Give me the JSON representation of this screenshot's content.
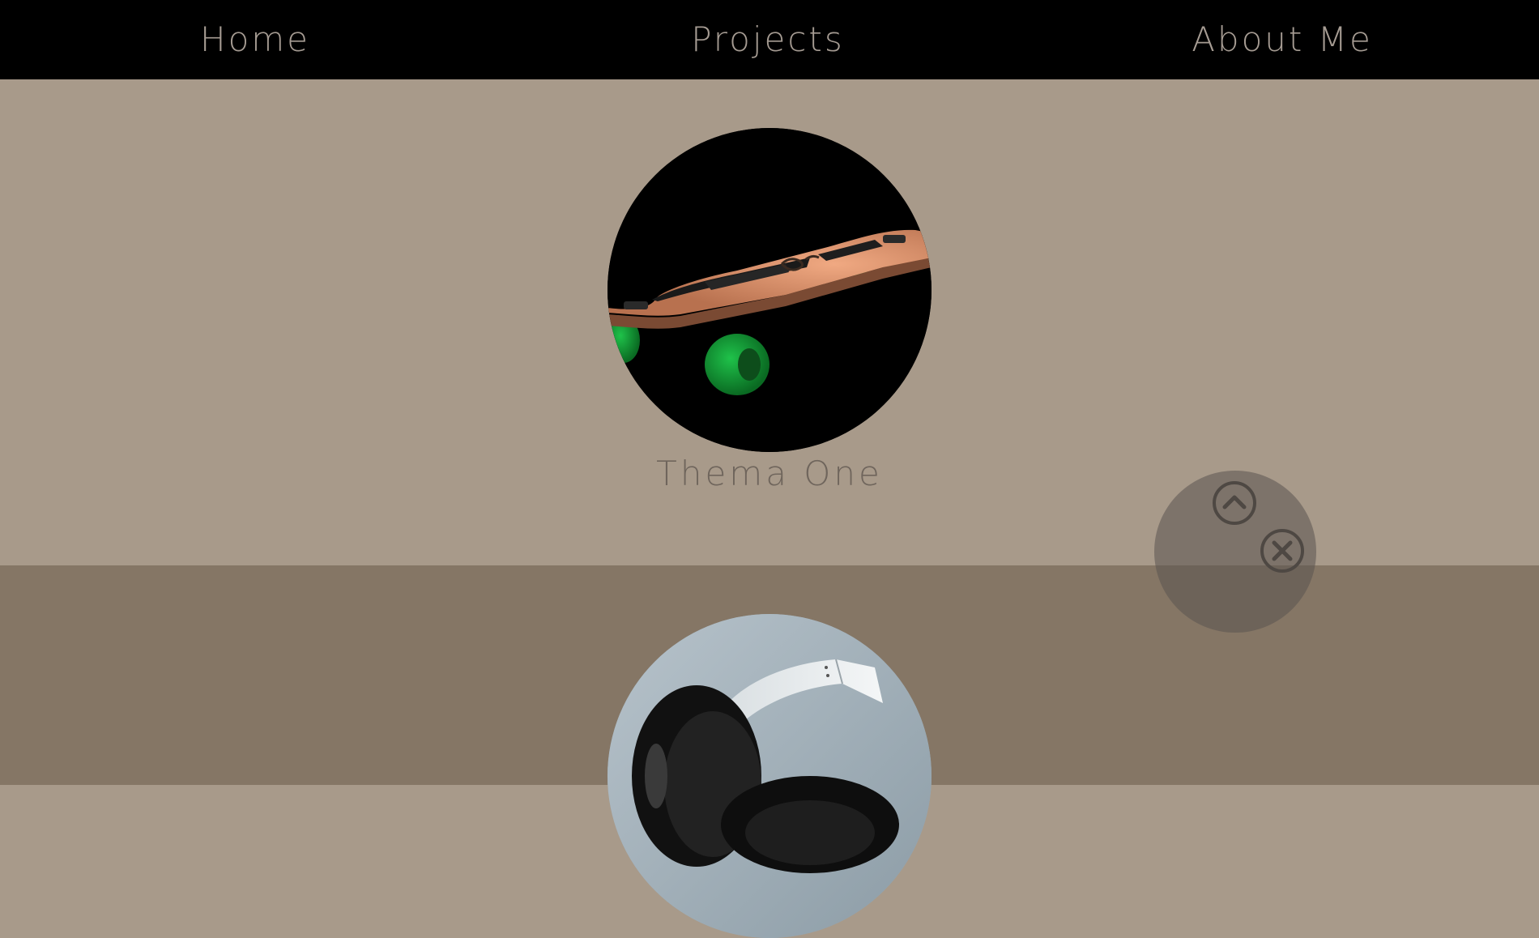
{
  "nav": {
    "home_label": "Home",
    "projects_label": "Projects",
    "about_label": "About Me",
    "background": "#000000",
    "text_color": "#a69c93"
  },
  "sections": {
    "one": {
      "title": "Thema One",
      "background": "#a89a8a",
      "image": "skateboard-longboard"
    },
    "two": {
      "background": "#857665",
      "image": "headphones"
    }
  },
  "controls": {
    "up_icon": "chevron-up-circle-icon",
    "close_icon": "close-circle-icon"
  }
}
